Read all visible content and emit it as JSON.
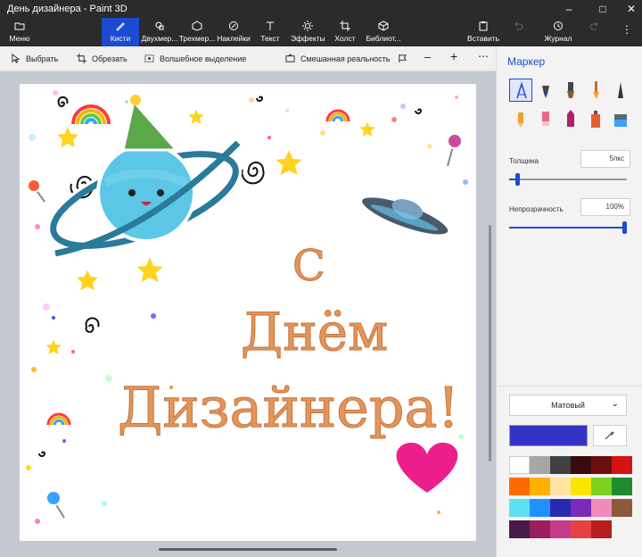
{
  "window": {
    "title": "День дизайнера - Paint 3D"
  },
  "ribbon": {
    "menu": "Меню",
    "brushes": "Кисти",
    "shapes2d": "Двухмер...",
    "shapes3d": "Трехмер...",
    "stickers": "Наклейки",
    "text": "Текст",
    "effects": "Эффекты",
    "canvas": "Холст",
    "library": "Библиот...",
    "paste": "Вставить",
    "history": "Журнал"
  },
  "toolbar": {
    "select": "Выбрать",
    "crop": "Обрезать",
    "magic_select": "Волшебное выделение",
    "mixed_reality": "Смешанная реальность"
  },
  "canvas": {
    "line1": "С",
    "line2": "Днём",
    "line3": "Дизайнера!"
  },
  "panel": {
    "title": "Маркер",
    "thickness_label": "Толщина",
    "thickness_value": "5пкс",
    "thickness_fraction": 0.05,
    "opacity_label": "Непрозрачность",
    "opacity_value": "100%",
    "opacity_fraction": 1.0,
    "finish": "Матовый",
    "current_color": "#3434c4",
    "palette": [
      "#ffffff",
      "#a6a6a6",
      "#404040",
      "#3a0a0a",
      "#6b0f0f",
      "#d41414",
      "#ff6a00",
      "#ffb000",
      "#fde4a0",
      "#f7e600",
      "#7cd11e",
      "#1e8c2e",
      "#5ce0f2",
      "#1e90ff",
      "#2a2ab0",
      "#7a2ab8",
      "#f08ab8",
      "#8b5a3c",
      "#4a1a4a",
      "#9a1e5a",
      "#c83a8a",
      "#e84040",
      "#b81e1e",
      ""
    ]
  }
}
